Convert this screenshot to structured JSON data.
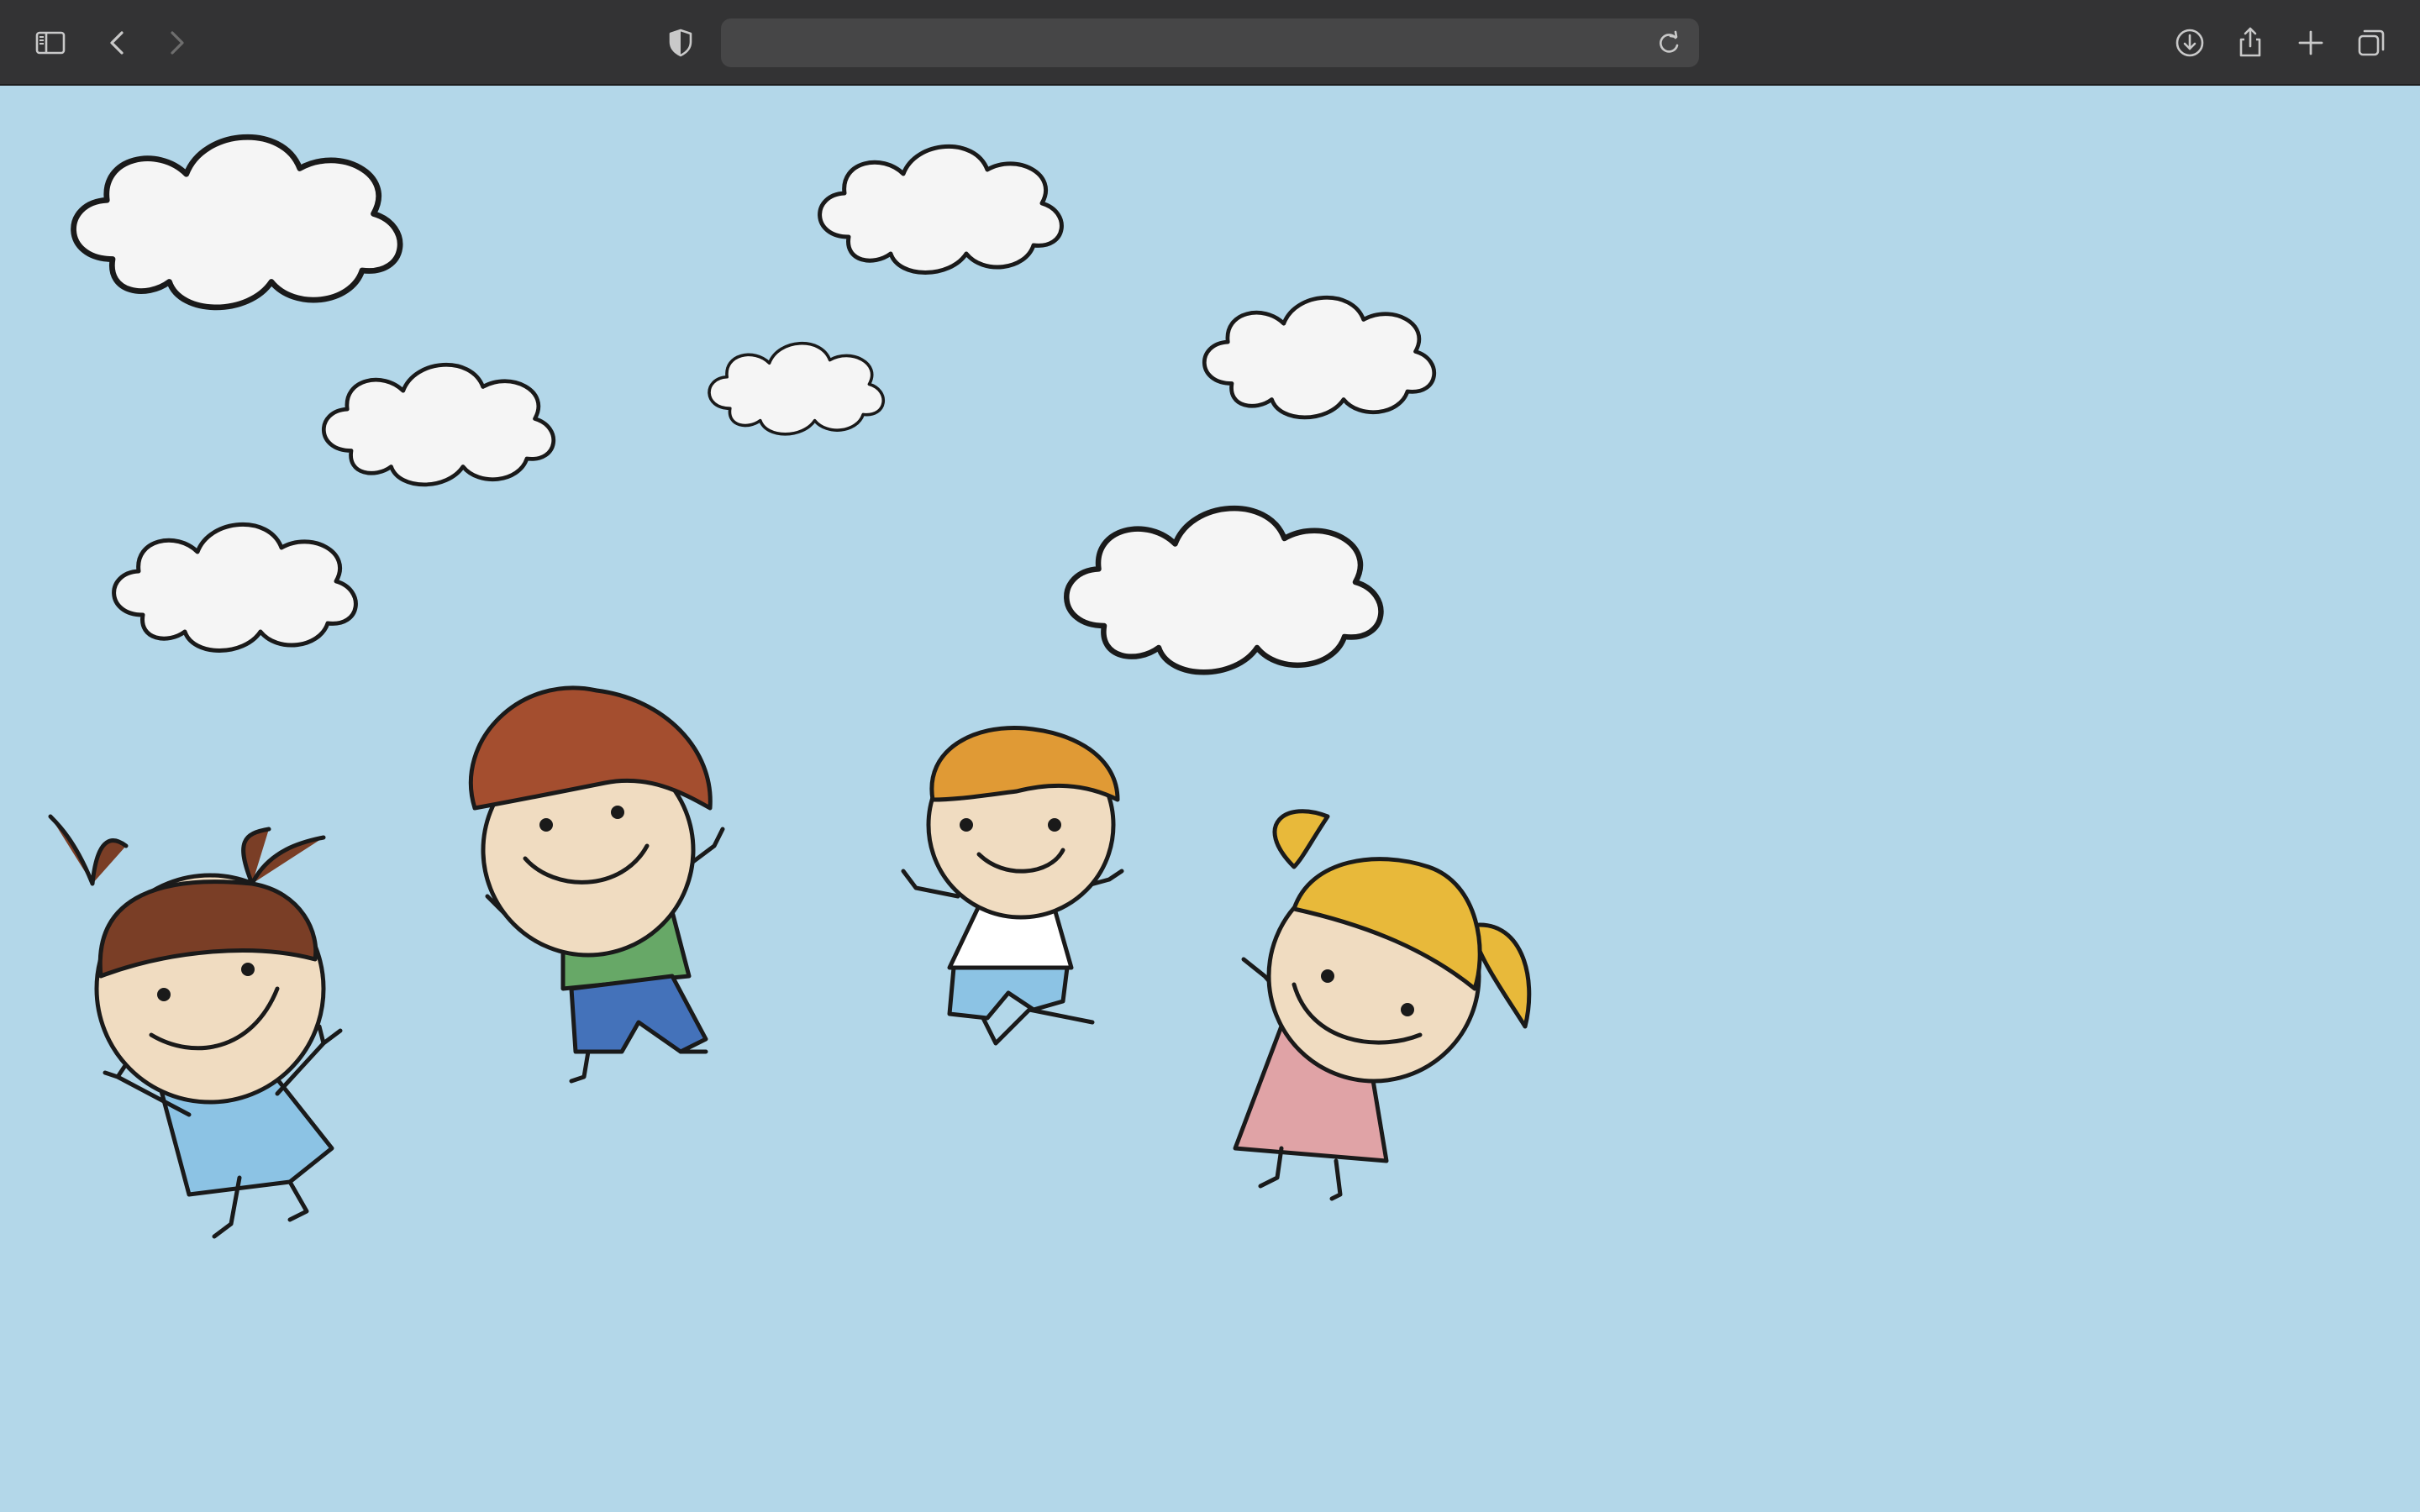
{
  "browser": {
    "address_value": "",
    "address_placeholder": "",
    "icons": {
      "sidebar": "sidebar-icon",
      "back": "chevron-left-icon",
      "forward": "chevron-right-icon",
      "privacy": "shield-icon",
      "reload": "reload-icon",
      "downloads": "download-icon",
      "share": "share-icon",
      "new_tab": "plus-icon",
      "tabs": "tab-overview-icon"
    },
    "colors": {
      "toolbar": "#333334",
      "address_bar": "#464647",
      "icon": "#c9c9c9"
    }
  },
  "illustration": {
    "background_color": "#b3d7e9",
    "cloud_color": "#f5f5f5",
    "outline_color": "#1a1a1a",
    "skin_color": "#f0dcc1",
    "children": [
      {
        "name": "girl-pigtails",
        "hair": "#7a3e26",
        "outfit": "#8cc3e4"
      },
      {
        "name": "boy-red-hair",
        "hair": "#a44e2f",
        "shirt": "#67a867",
        "pants": "#4472ba"
      },
      {
        "name": "boy-orange-hair",
        "hair": "#e09a35",
        "shirt": "#ffffff",
        "pants": "#8cc3e4"
      },
      {
        "name": "girl-ponytail",
        "hair": "#e8b93a",
        "outfit": "#e0a3a6"
      }
    ]
  }
}
